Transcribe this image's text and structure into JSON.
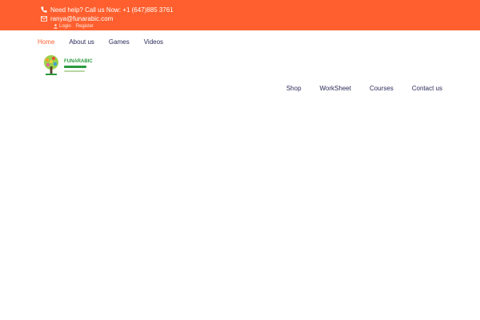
{
  "topbar": {
    "phone_text": "Need help? Call us Now: +1 (647)885 3761",
    "email_text": "ranya@funarabic.com",
    "login": "Login",
    "register": "Register"
  },
  "nav_top": {
    "items": [
      "Home",
      "About us",
      "Games",
      "Videos"
    ],
    "active": "Home"
  },
  "logo": {
    "text": "FUNARABIC"
  },
  "nav_right": {
    "items": [
      "Shop",
      "WorkSheet",
      "Courses",
      "Contact us"
    ]
  },
  "colors": {
    "brand": "#ff5f2e",
    "nav_text": "#2b2a5a",
    "background": "#ffffff"
  }
}
